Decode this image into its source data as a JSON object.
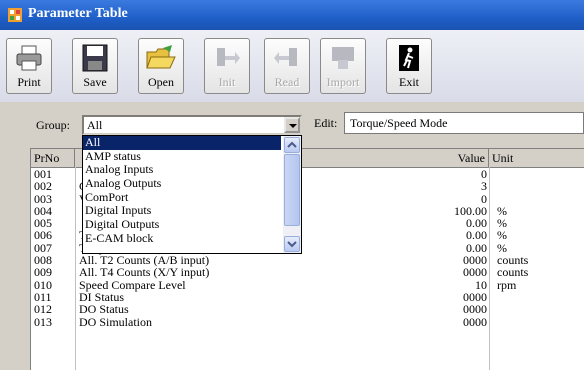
{
  "window": {
    "title": "Parameter Table"
  },
  "toolbar": {
    "buttons": [
      {
        "label": "Print",
        "icon": "printer-icon",
        "enabled": true
      },
      {
        "label": "Save",
        "icon": "floppy-disk-icon",
        "enabled": true
      },
      {
        "label": "Open",
        "icon": "folder-open-icon",
        "enabled": true
      },
      {
        "label": "Init",
        "icon": "init-arrow-icon",
        "enabled": false
      },
      {
        "label": "Read",
        "icon": "read-arrow-icon",
        "enabled": false
      },
      {
        "label": "Import",
        "icon": "import-icon",
        "enabled": false
      },
      {
        "label": "Exit",
        "icon": "exit-door-icon",
        "enabled": true
      }
    ]
  },
  "group": {
    "label": "Group:",
    "value": "All"
  },
  "edit": {
    "label": "Edit:",
    "value": "Torque/Speed Mode"
  },
  "group_dropdown": {
    "items": [
      "All",
      "AMP status",
      "Analog Inputs",
      "Analog Outputs",
      "ComPort",
      "Digital Inputs",
      "Digital Outputs",
      "E-CAM block"
    ],
    "selected": "All"
  },
  "table": {
    "headers": {
      "no": "PrNo",
      "value": "Value",
      "unit": "Unit"
    },
    "rows": [
      {
        "no": "001",
        "name": "",
        "value": "0",
        "unit": ""
      },
      {
        "no": "002",
        "name": "G)",
        "value": "3",
        "unit": ""
      },
      {
        "no": "003",
        "name": "V=00",
        "value": "0",
        "unit": ""
      },
      {
        "no": "004",
        "name": "",
        "value": "100.00",
        "unit": "%"
      },
      {
        "no": "005",
        "name": "",
        "value": "0.00",
        "unit": "%"
      },
      {
        "no": "006",
        "name": "Torque Limit-2 (EAROM)",
        "value": "0.00",
        "unit": "%"
      },
      {
        "no": "007",
        "name": "Torque Limit-3 (EAROM)",
        "value": "0.00",
        "unit": "%"
      },
      {
        "no": "008",
        "name": "All. T2 Counts (A/B input)",
        "value": "0000",
        "unit": "counts"
      },
      {
        "no": "009",
        "name": "All. T4 Counts (X/Y input)",
        "value": "0000",
        "unit": "counts"
      },
      {
        "no": "010",
        "name": "Speed Compare Level",
        "value": "10",
        "unit": "rpm"
      },
      {
        "no": "011",
        "name": "DI Status",
        "value": "0000",
        "unit": ""
      },
      {
        "no": "012",
        "name": "DO Status",
        "value": "0000",
        "unit": ""
      },
      {
        "no": "013",
        "name": "DO Simulation",
        "value": "0000",
        "unit": ""
      }
    ]
  }
}
